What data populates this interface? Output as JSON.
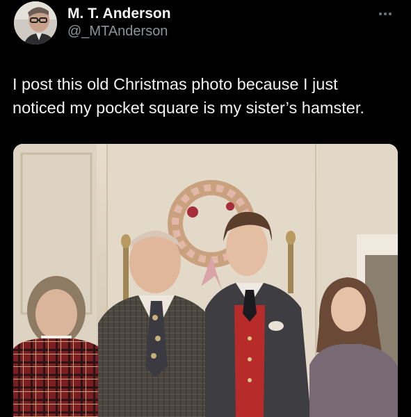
{
  "post": {
    "author": {
      "display_name": "M. T. Anderson",
      "handle": "@_MTAnderson",
      "avatar_icon": "profile-photo-avatar"
    },
    "more_icon": "more-horizontal-icon",
    "text_lines": [
      "I post this old Christmas photo because I just",
      "noticed my pocket square is my sister’s hamster."
    ],
    "media": {
      "kind": "photo",
      "subject": "family-christmas-photo"
    }
  },
  "colors": {
    "background": "#000000",
    "text_primary": "#e7e9ea",
    "text_secondary": "#8b949b"
  }
}
